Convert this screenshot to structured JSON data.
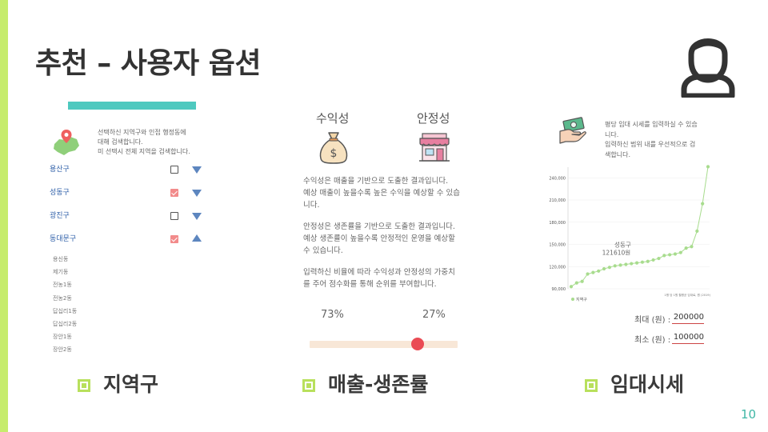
{
  "slide": {
    "title": "추천 – 사용자 옵션",
    "page_number": "10",
    "colors": {
      "accent_bar": "#c6ec6d",
      "accent_teal": "#4ec9bf",
      "bullet": "#b8e05c",
      "slider_thumb": "#ea4b54"
    }
  },
  "district_panel": {
    "description": [
      "선택하신 지역구와 인접 행정동에",
      "대해 검색합니다.",
      "미 선택시 전체 지역을 검색합니다."
    ],
    "districts": [
      {
        "name": "용산구",
        "checked": false,
        "expanded": false
      },
      {
        "name": "성동구",
        "checked": true,
        "expanded": false
      },
      {
        "name": "광진구",
        "checked": false,
        "expanded": false
      },
      {
        "name": "동대문구",
        "checked": true,
        "expanded": true
      }
    ],
    "dongs": [
      "용신동",
      "제기동",
      "전농1동",
      "전농2동",
      "답십리1동",
      "답십리2동",
      "장안1동",
      "장안2동"
    ]
  },
  "sales_panel": {
    "profit_label": "수익성",
    "stability_label": "안정성",
    "paragraphs": [
      [
        "수익성은 매출을 기반으로 도출한 결과입니다.",
        "예상 매출이 높을수록 높은 수익을 예상할 수 있습",
        "니다."
      ],
      [
        "안정성은 생존률을 기반으로 도출한 결과입니다.",
        "예상 생존률이 높을수록 안정적인 운영을 예상할",
        "수 있습니다."
      ],
      [
        "입력하신 비율에 따라 수익성과 안정성의 가중치",
        "를 주어 점수화를 통해 순위를 부여합니다."
      ]
    ],
    "profit_pct": "73%",
    "stability_pct": "27%",
    "slider_value": 0.73
  },
  "rent_panel": {
    "description": [
      "평당 임대 시세를 입력하실 수 있습",
      "니다.",
      "입력하신 범위 내를 우선적으로 검",
      "색합니다."
    ],
    "max_label": "최대 (원) :",
    "max_value": "200000",
    "min_label": "최소 (원) :",
    "min_value": "100000"
  },
  "chart_data": {
    "type": "line",
    "title": "",
    "xlabel": "",
    "ylabel": "",
    "ylim": [
      90000,
      250000
    ],
    "yticks": [
      90000,
      120000,
      150000,
      180000,
      210000,
      240000
    ],
    "ytick_labels": [
      "90,000",
      "120,000",
      "150,000",
      "180,000",
      "210,000",
      "240,000"
    ],
    "series": [
      {
        "name": "지역구",
        "color": "#a8dc8e",
        "values": [
          93000,
          98000,
          100000,
          110000,
          112000,
          114000,
          117000,
          119000,
          121000,
          122000,
          123000,
          124000,
          125000,
          126000,
          127000,
          129000,
          131000,
          135000,
          136000,
          137000,
          139000,
          145000,
          147000,
          168000,
          205000,
          255000
        ]
      }
    ],
    "annotation": {
      "lines": [
        "성동구",
        "121610원"
      ],
      "index": 10
    },
    "footnote": "1평 당 1원 월평균 임대료, 원 (2019)",
    "grid": true,
    "legend": "bottom-left"
  },
  "captions": {
    "district": "지역구",
    "sales": "매출-생존률",
    "rent": "임대시세"
  }
}
